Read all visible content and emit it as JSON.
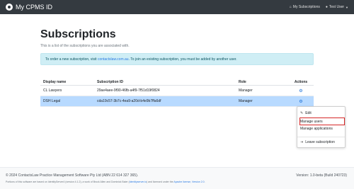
{
  "navbar": {
    "brand": "My CPMS ID",
    "subscriptions_link": "My Subscriptions",
    "user_menu": "Test User"
  },
  "page": {
    "title": "Subscriptions",
    "subtitle": "This is a list of the subscriptions you are associated with.",
    "alert_prefix": "To order a new subscription, visit ",
    "alert_link": "contactslaw.com.au",
    "alert_suffix": ". To join an existing subscription, you must be added by another user."
  },
  "table": {
    "headers": [
      "Display name",
      "Subscription ID",
      "Role",
      "Actions"
    ],
    "rows": [
      {
        "name": "CL Lawyers",
        "id": "29ae4aee-9f90-46fb-a4f9-7f51d19f0824",
        "role": "Manager"
      },
      {
        "name": "DSH Legal",
        "id": "cda19c57-3b7c-4ea9-a20d-b4e9b7ffa6df",
        "role": "Manager"
      }
    ]
  },
  "dropdown": {
    "items": [
      "Edit",
      "Manage users",
      "Manage applications",
      "Leave subscription"
    ]
  },
  "footer": {
    "copyright": "© 2024 ContactsLaw Practice Management Software Pty Ltd (ABN 22 614 327 365).",
    "version": "Version: 1.0-beta (Build 240723)",
    "attribution_1": "Portions of this software are based on IdentityServer4 (version 4.1.2), a work of Brock Allen and Dominick Baier (",
    "attribution_link_1": "identityserver.io",
    "attribution_2": ") and licensed under the ",
    "attribution_link_2": "Apache license, Version 2.0",
    "attribution_3": "."
  },
  "colors": {
    "navbar": "#343a40",
    "selected_row": "#b8daff",
    "alert_bg": "#cfeef5",
    "highlight_box": "#d62828",
    "link": "#2a7ae2"
  },
  "icons": [
    "brand-logo-icon",
    "home-icon",
    "user-icon",
    "gear-icon",
    "pencil-icon",
    "sign-out-icon"
  ]
}
